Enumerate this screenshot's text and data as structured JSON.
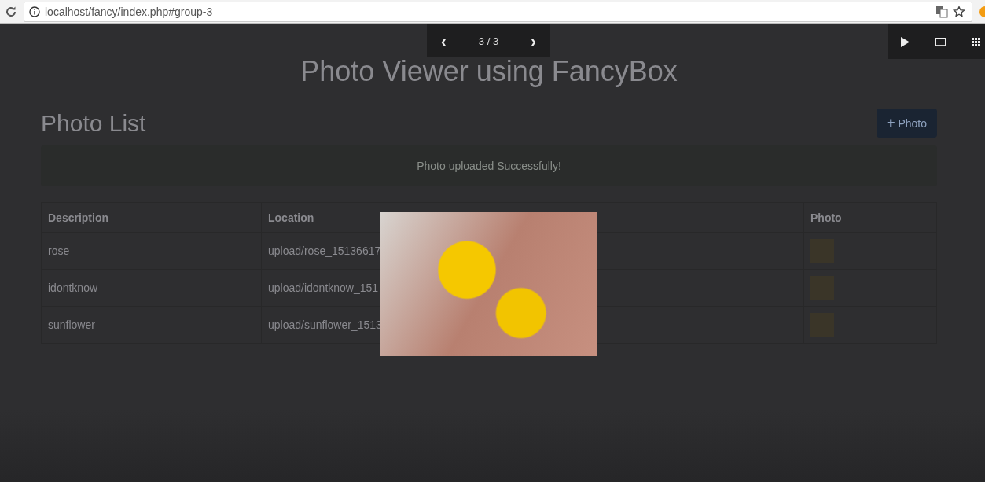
{
  "browser": {
    "url": "localhost/fancy/index.php#group-3"
  },
  "page": {
    "title": "Photo Viewer using FancyBox",
    "heading": "Photo List",
    "add_button": {
      "icon": "+",
      "label": "Photo"
    },
    "alert": "Photo uploaded Successfully!",
    "table": {
      "columns": [
        "Description",
        "Location",
        "Photo"
      ],
      "rows": [
        {
          "description": "rose",
          "location": "upload/rose_15136617"
        },
        {
          "description": "idontknow",
          "location": "upload/idontknow_151"
        },
        {
          "description": "sunflower",
          "location": "upload/sunflower_1513"
        }
      ]
    }
  },
  "lightbox": {
    "counter": "3 / 3",
    "prev": "‹",
    "next": "›"
  }
}
